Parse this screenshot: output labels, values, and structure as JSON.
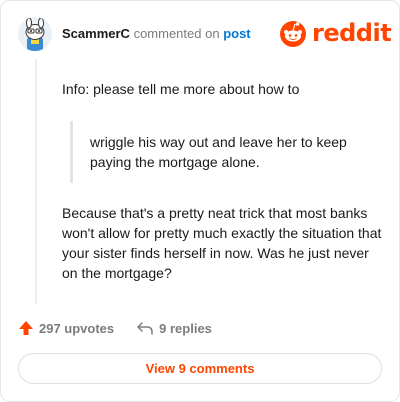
{
  "header": {
    "username": "ScammerC",
    "verb": "commented on",
    "post_link": "post"
  },
  "brand": {
    "logo_text": "reddit",
    "accent_color": "#ff4500"
  },
  "comment": {
    "line1": "Info: please tell me more about how to",
    "quote": "wriggle his way out and leave her to keep paying the mortgage alone.",
    "body": "Because that's a pretty neat trick that most banks won't allow for pretty much exactly the situation that your sister finds herself in now. Was he just never on the mortgage?"
  },
  "footer": {
    "upvotes": "297 upvotes",
    "replies": "9 replies",
    "view_comments": "View 9 comments"
  },
  "icons": {
    "avatar": "snoo-avatar-icon",
    "logo": "reddit-snoo-icon",
    "upvote": "upvote-arrow-icon",
    "reply": "reply-arrow-icon"
  }
}
